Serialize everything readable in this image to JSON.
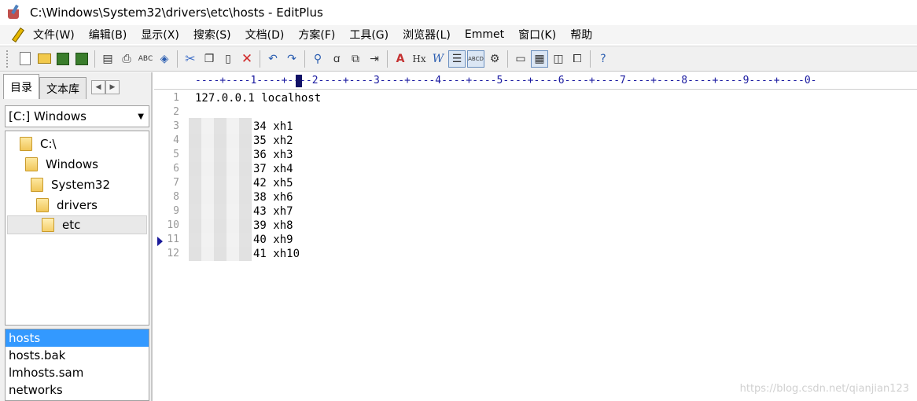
{
  "window": {
    "title": "C:\\Windows\\System32\\drivers\\etc\\hosts - EditPlus"
  },
  "menu": [
    "文件(W)",
    "编辑(B)",
    "显示(X)",
    "搜索(S)",
    "文档(D)",
    "方案(F)",
    "工具(G)",
    "浏览器(L)",
    "Emmet",
    "窗口(K)",
    "帮助"
  ],
  "toolbar": {
    "abc_label": "ABC",
    "hx_label": "Hx",
    "w_label": "W",
    "abcd_label": "ABCD",
    "a_label": "A"
  },
  "panel": {
    "tabs": [
      "目录",
      "文本库"
    ],
    "drive": "[C:] Windows",
    "tree": [
      "C:\\",
      "Windows",
      "System32",
      "drivers",
      "etc"
    ],
    "files": [
      "hosts",
      "hosts.bak",
      "lmhosts.sam",
      "networks"
    ]
  },
  "editor": {
    "ruler": "----+----1----+----2----+----3----+----4----+----5----+----6----+----7----+----8----+----9----+----0-",
    "lines": [
      {
        "num": "1",
        "text": "127.0.0.1 localhost"
      },
      {
        "num": "2",
        "text": ""
      },
      {
        "num": "3",
        "text": "34 xh1"
      },
      {
        "num": "4",
        "text": "35 xh2"
      },
      {
        "num": "5",
        "text": "36 xh3"
      },
      {
        "num": "6",
        "text": "37 xh4"
      },
      {
        "num": "7",
        "text": "42 xh5"
      },
      {
        "num": "8",
        "text": "38 xh6"
      },
      {
        "num": "9",
        "text": "43 xh7"
      },
      {
        "num": "10",
        "text": "39 xh8"
      },
      {
        "num": "11",
        "text": "40 xh9"
      },
      {
        "num": "12",
        "text": "41 xh10"
      }
    ]
  },
  "watermark": "https://blog.csdn.net/qianjian123"
}
